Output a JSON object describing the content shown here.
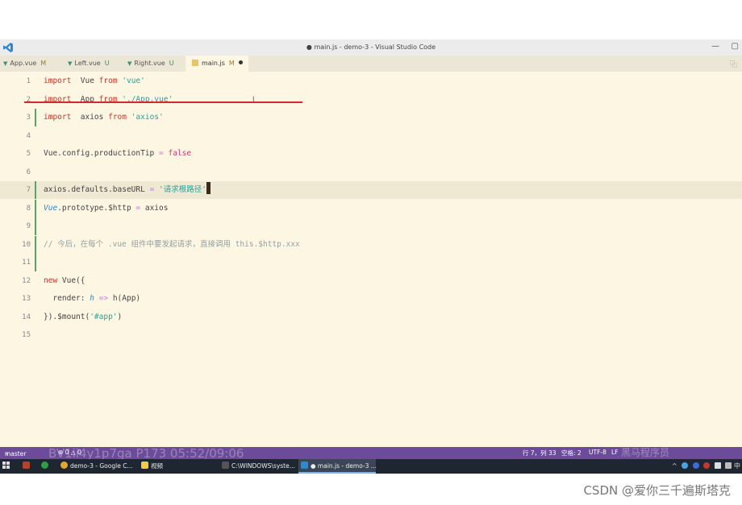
{
  "window": {
    "title": "● main.js - demo-3 - Visual Studio Code",
    "minimize": "—",
    "restore": "▢"
  },
  "tabs": [
    {
      "name": "App.vue",
      "mark": "M"
    },
    {
      "name": "Left.vue",
      "mark": "U"
    },
    {
      "name": "Right.vue",
      "mark": "U"
    },
    {
      "name": "main.js",
      "mark": "M"
    }
  ],
  "editor": {
    "lines": [
      {
        "n": "1",
        "tokens": [
          [
            "kw",
            "import"
          ],
          [
            "",
            "  Vue "
          ],
          [
            "kw",
            "from"
          ],
          [
            "",
            ""
          ],
          [
            "str",
            " 'vue'"
          ]
        ]
      },
      {
        "n": "2",
        "tokens": [
          [
            "kw",
            "import"
          ],
          [
            "",
            "  App "
          ],
          [
            "kw",
            "from"
          ],
          [
            "str",
            " './App.vue'"
          ]
        ]
      },
      {
        "n": "3",
        "tokens": [
          [
            "kw",
            "import"
          ],
          [
            "",
            "  axios "
          ],
          [
            "kw",
            "from"
          ],
          [
            "str",
            " 'axios'"
          ]
        ]
      },
      {
        "n": "4",
        "tokens": []
      },
      {
        "n": "5",
        "tokens": [
          [
            "",
            "Vue.config.productionTip "
          ],
          [
            "op",
            "="
          ],
          [
            "bool",
            " false"
          ]
        ]
      },
      {
        "n": "6",
        "tokens": []
      },
      {
        "n": "7",
        "tokens": [
          [
            "",
            "axios.defaults.baseURL "
          ],
          [
            "op",
            "="
          ],
          [
            "str",
            " '请求根路径'"
          ]
        ]
      },
      {
        "n": "8",
        "tokens": [
          [
            "it",
            "Vue"
          ],
          [
            "",
            ".prototype.$http "
          ],
          [
            "op",
            "="
          ],
          [
            "",
            " axios"
          ]
        ]
      },
      {
        "n": "9",
        "tokens": []
      },
      {
        "n": "10",
        "tokens": [
          [
            "cmt",
            "// 今后，在每个 .vue 组件中要发起请求，直接调用 this.$http.xxx"
          ]
        ]
      },
      {
        "n": "11",
        "tokens": []
      },
      {
        "n": "12",
        "tokens": [
          [
            "kw",
            "new"
          ],
          [
            "",
            " Vue({"
          ]
        ]
      },
      {
        "n": "13",
        "tokens": [
          [
            "",
            "  render: "
          ],
          [
            "it",
            "h"
          ],
          [
            "op",
            " =>"
          ],
          [
            "",
            " h(App)"
          ]
        ]
      },
      {
        "n": "14",
        "tokens": [
          [
            "",
            "}).$mount("
          ],
          [
            "str",
            "'#app'"
          ],
          [
            "",
            ")"
          ]
        ]
      },
      {
        "n": "15",
        "tokens": []
      }
    ]
  },
  "statusbar": {
    "branch": "master",
    "sync": "⊗ 0 △ 0",
    "position": "行 7，列 33",
    "spaces": "空格: 2",
    "encoding": "UTF-8",
    "eol": "LF",
    "watermark": "BV1ii4y1p7ga P173 05:52/09:06",
    "brand": "黑马程序员"
  },
  "taskbar": {
    "items": [
      "demo-3 - Google C...",
      "视频",
      "C:\\WINDOWS\\syste...",
      "● main.js - demo-3 ..."
    ],
    "lang": "中"
  },
  "footer": {
    "credit": "CSDN @爱你三千遍斯塔克"
  }
}
